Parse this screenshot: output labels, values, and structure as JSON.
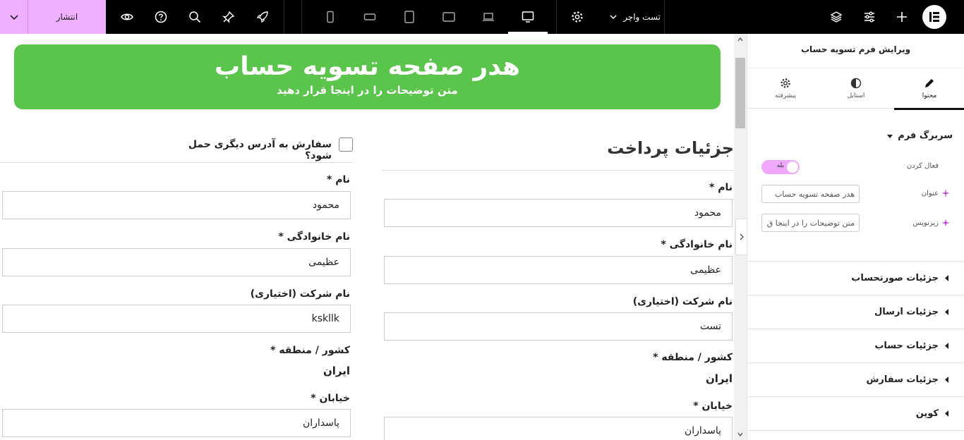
{
  "topbar": {
    "publish_label": "انتشار",
    "page_name": "تست واچر"
  },
  "hero": {
    "title": "هدر صفحه تسویه حساب",
    "subtitle": "متن توضیحات را در اینجا قرار دهید"
  },
  "billing": {
    "title": "جزئیات پرداخت",
    "first_name_label": "نام *",
    "first_name_value": "محمود",
    "last_name_label": "نام خانوادگی *",
    "last_name_value": "عظیمی",
    "company_label": "نام شرکت (اختیاری)",
    "company_value": "تست",
    "country_label": "کشور / منطقه *",
    "country_value": "ایران",
    "street_label": "خیابان *",
    "street_value": "پاسداران"
  },
  "shipping": {
    "checkbox_label": "سفارش به آدرس دیگری حمل شود؟",
    "first_name_label": "نام *",
    "first_name_value": "محمود",
    "last_name_label": "نام خانوادگی *",
    "last_name_value": "عظیمی",
    "company_label": "نام شرکت (اختیاری)",
    "company_value": "kskllk",
    "country_label": "کشور / منطقه *",
    "country_value": "ایران",
    "street_label": "خیابان *",
    "street_value": "پاسداران"
  },
  "panel": {
    "title": "ویرایش فرم تسویه حساب",
    "tabs": [
      {
        "label": "محتوا"
      },
      {
        "label": "استایل"
      },
      {
        "label": "پیشرفته"
      }
    ],
    "section_header": "سربرگ فرم",
    "enable_label": "فعال کردن",
    "enable_value": "بله",
    "title_label": "عنوان",
    "title_value": "هدر صفحه تسویه حساب",
    "subtitle_label": "زیرنویس",
    "subtitle_value": "متن توضیحات را در اینجا ق",
    "accordions": [
      {
        "label": "جزئیات صورتحساب"
      },
      {
        "label": "جزئیات ارسال"
      },
      {
        "label": "جزئیات حساب"
      },
      {
        "label": "جزئیات سفارش"
      },
      {
        "label": "کوپن"
      }
    ]
  },
  "colors": {
    "accent": "#eeb0ff",
    "hero": "#5bc44c"
  }
}
